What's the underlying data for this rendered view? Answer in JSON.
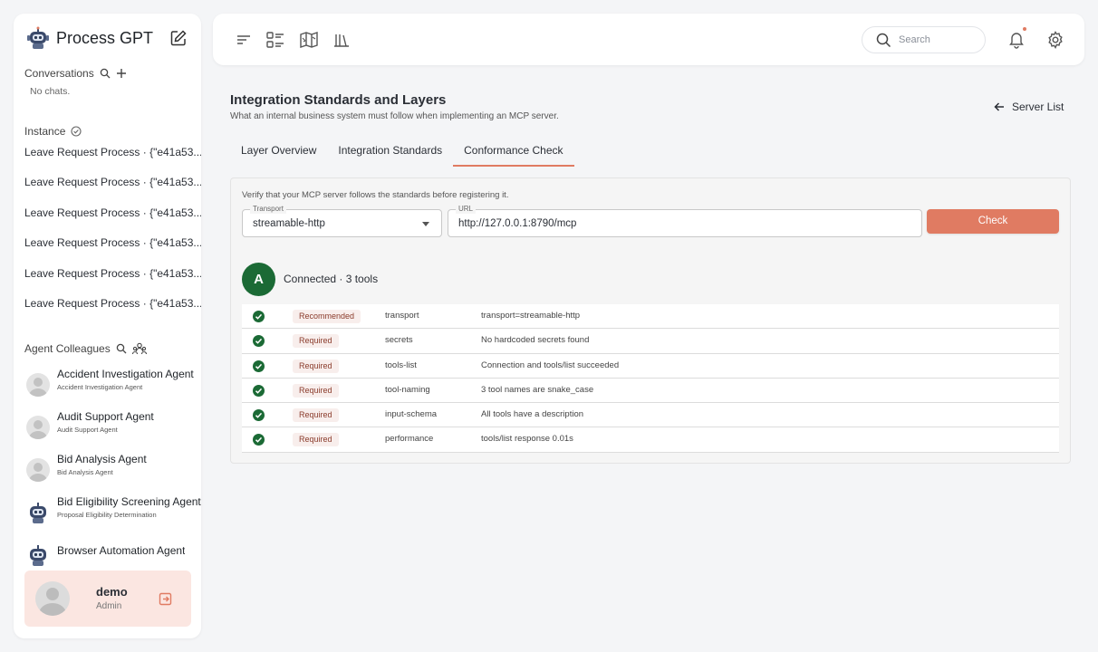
{
  "app": {
    "name": "Process GPT"
  },
  "sidebar": {
    "conversations": {
      "title": "Conversations",
      "empty": "No chats."
    },
    "instance": {
      "title": "Instance",
      "items": [
        "Leave Request Process · {\"e41a53...",
        "Leave Request Process · {\"e41a53...",
        "Leave Request Process · {\"e41a53...",
        "Leave Request Process · {\"e41a53...",
        "Leave Request Process · {\"e41a53...",
        "Leave Request Process · {\"e41a53..."
      ]
    },
    "agents": {
      "title": "Agent Colleagues",
      "items": [
        {
          "name": "Accident Investigation Agent",
          "sub": "Accident Investigation Agent",
          "avatar": "person"
        },
        {
          "name": "Audit Support Agent",
          "sub": "Audit Support Agent",
          "avatar": "person"
        },
        {
          "name": "Bid Analysis Agent",
          "sub": "Bid Analysis Agent",
          "avatar": "person"
        },
        {
          "name": "Bid Eligibility Screening Agent",
          "sub": "Proposal Eligibility Determination",
          "avatar": "robot"
        },
        {
          "name": "Browser Automation Agent",
          "sub": "",
          "avatar": "robot"
        }
      ]
    },
    "user": {
      "name": "demo",
      "role": "Admin"
    }
  },
  "topbar": {
    "search_placeholder": "Search"
  },
  "main": {
    "title": "Integration Standards and Layers",
    "subtitle": "What an internal business system must follow when implementing an MCP server.",
    "back_label": "Server List",
    "tabs": [
      "Layer Overview",
      "Integration Standards",
      "Conformance Check"
    ],
    "active_tab": 2,
    "check": {
      "intro": "Verify that your MCP server follows the standards before registering it.",
      "transport_label": "Transport",
      "transport_value": "streamable-http",
      "url_label": "URL",
      "url_value": "http://127.0.0.1:8790/mcp",
      "button": "Check",
      "avatar_letter": "A",
      "status": "Connected · 3 tools",
      "results": [
        {
          "level": "Recommended",
          "key": "transport",
          "message": "transport=streamable-http"
        },
        {
          "level": "Required",
          "key": "secrets",
          "message": "No hardcoded secrets found"
        },
        {
          "level": "Required",
          "key": "tools-list",
          "message": "Connection and tools/list succeeded"
        },
        {
          "level": "Required",
          "key": "tool-naming",
          "message": "3 tool names are snake_case"
        },
        {
          "level": "Required",
          "key": "input-schema",
          "message": "All tools have a description"
        },
        {
          "level": "Required",
          "key": "performance",
          "message": "tools/list response 0.01s"
        }
      ]
    }
  },
  "colors": {
    "accent": "#e07b62",
    "success": "#1b6a35",
    "connected": "#1b6a35"
  }
}
